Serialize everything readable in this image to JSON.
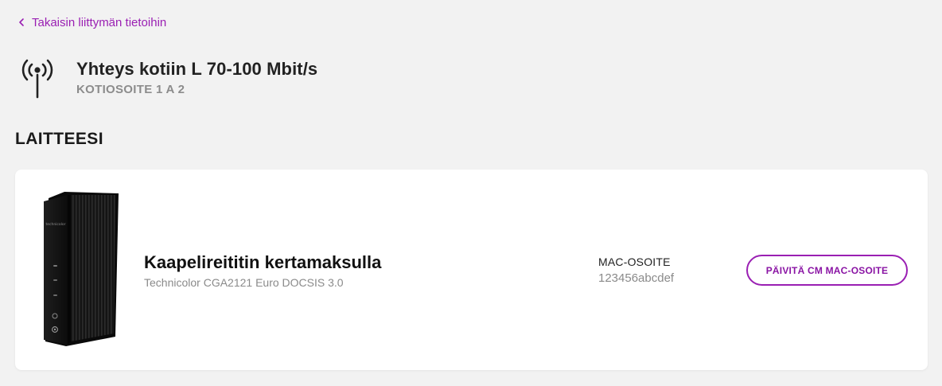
{
  "nav": {
    "back_label": "Takaisin liittymän tietoihin",
    "back_icon": "chevron-left-icon"
  },
  "service": {
    "icon": "antenna-signal-icon",
    "title": "Yhteys kotiin L 70-100 Mbit/s",
    "address": "KOTIOSOITE 1 A 2"
  },
  "devices_section": {
    "heading": "LAITTEESI"
  },
  "device": {
    "name": "Kaapelireititin kertamaksulla",
    "model": "Technicolor CGA2121 Euro DOCSIS 3.0",
    "brand_mark": "technicolor",
    "mac_label": "MAC-OSOITE",
    "mac_value": "123456abcdef",
    "update_button_label": "PÄIVITÄ CM MAC-OSOITE"
  },
  "colors": {
    "accent": "#9a1fb3",
    "background": "#f2f2f2",
    "card": "#ffffff",
    "muted_text": "#8a8a8a"
  }
}
